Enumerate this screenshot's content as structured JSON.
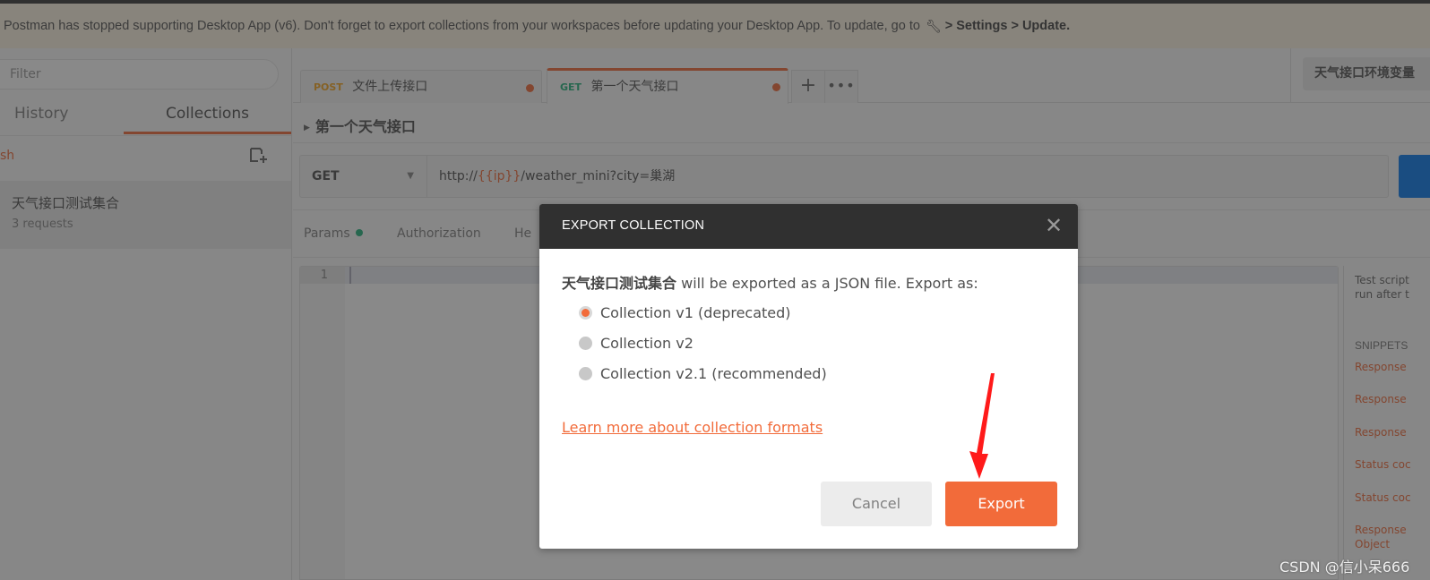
{
  "banner": {
    "text": "Postman has stopped supporting Desktop App (v6). Don't forget to export collections from your workspaces before updating your Desktop App. To update, go to",
    "icon": "wrench-icon",
    "path": "> Settings > Update."
  },
  "sidebar": {
    "filter_placeholder": "Filter",
    "tabs": [
      {
        "label": "History",
        "active": false
      },
      {
        "label": "Collections",
        "active": true
      }
    ],
    "trash_label": "sh",
    "collections": [
      {
        "name": "天气接口测试集合",
        "count": "3 requests"
      }
    ]
  },
  "main": {
    "tabs": [
      {
        "method": "POST",
        "method_color": "#f5a623",
        "name": "文件上传接口",
        "unsaved": true,
        "active": false
      },
      {
        "method": "GET",
        "method_color": "#26b47f",
        "name": "第一个天气接口",
        "unsaved": true,
        "active": true
      }
    ],
    "add_tab_label": "+",
    "more_tabs_label": "•••",
    "environment": "天气接口环境变量",
    "request_title": "第一个天气接口",
    "request": {
      "method": "GET",
      "url_prefix": "http://",
      "url_var": "{{ip}}",
      "url_suffix": "/weather_mini?city=巢湖"
    },
    "subtabs": [
      {
        "label": "Params",
        "has_dot": true
      },
      {
        "label": "Authorization"
      },
      {
        "label": "He"
      }
    ],
    "editor": {
      "line_numbers": [
        "1"
      ]
    },
    "right_panel": {
      "description_line1": "Test script",
      "description_line2": "run after t",
      "snippets_title": "SNIPPETS",
      "snippets": [
        "Response",
        "Response",
        "Response",
        "Status coc",
        "Status coc",
        "Response",
        "Object"
      ]
    }
  },
  "modal": {
    "title": "EXPORT COLLECTION",
    "close_icon": "close-icon",
    "collection_name": "天气接口测试集合",
    "description": " will be exported as a JSON file. Export as:",
    "options": [
      {
        "label": "Collection v1 (deprecated)",
        "checked": true
      },
      {
        "label": "Collection v2",
        "checked": false
      },
      {
        "label": "Collection v2.1 (recommended)",
        "checked": false
      }
    ],
    "learn_more": "Learn more about collection formats",
    "cancel_label": "Cancel",
    "export_label": "Export"
  },
  "colors": {
    "accent": "#f26b3a",
    "header_dark": "#303030",
    "annotation": "#ff1a1a"
  },
  "watermark": "CSDN @信小呆666"
}
